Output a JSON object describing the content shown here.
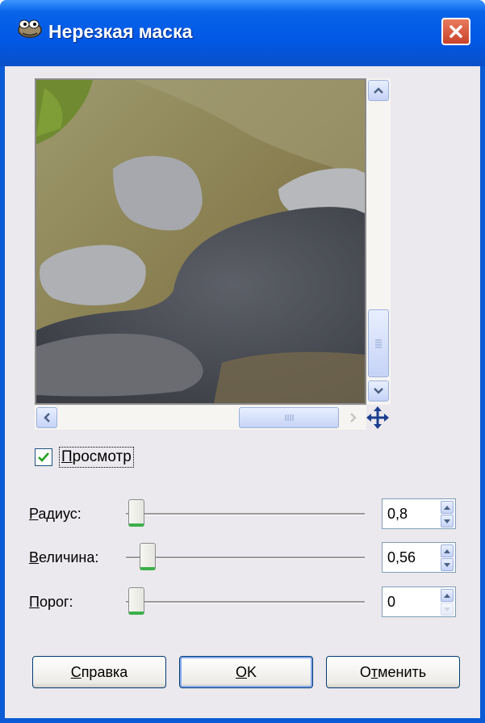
{
  "window": {
    "title": "Нерезкая маска"
  },
  "preview": {
    "checkbox_label_u": "П",
    "checkbox_label_rest": "росмотр",
    "checked": true
  },
  "params": [
    {
      "label_u": "Р",
      "label_rest": "адиус:",
      "value": "0,8",
      "level": 0.0
    },
    {
      "label_u": "В",
      "label_rest": "еличина:",
      "value": "0,56",
      "level": 0.05
    },
    {
      "label_u": "П",
      "label_rest": "орог:",
      "value": "0",
      "level": 0.0
    }
  ],
  "buttons": {
    "help_u": "С",
    "help_rest": "правка",
    "ok_u": "O",
    "ok_rest": "K",
    "cancel_a": "О",
    "cancel_u": "т",
    "cancel_b": "менить"
  },
  "colors": {
    "titlebar": "#0058e5",
    "client": "#ebe9ed",
    "accent_green": "#3cb04a"
  }
}
